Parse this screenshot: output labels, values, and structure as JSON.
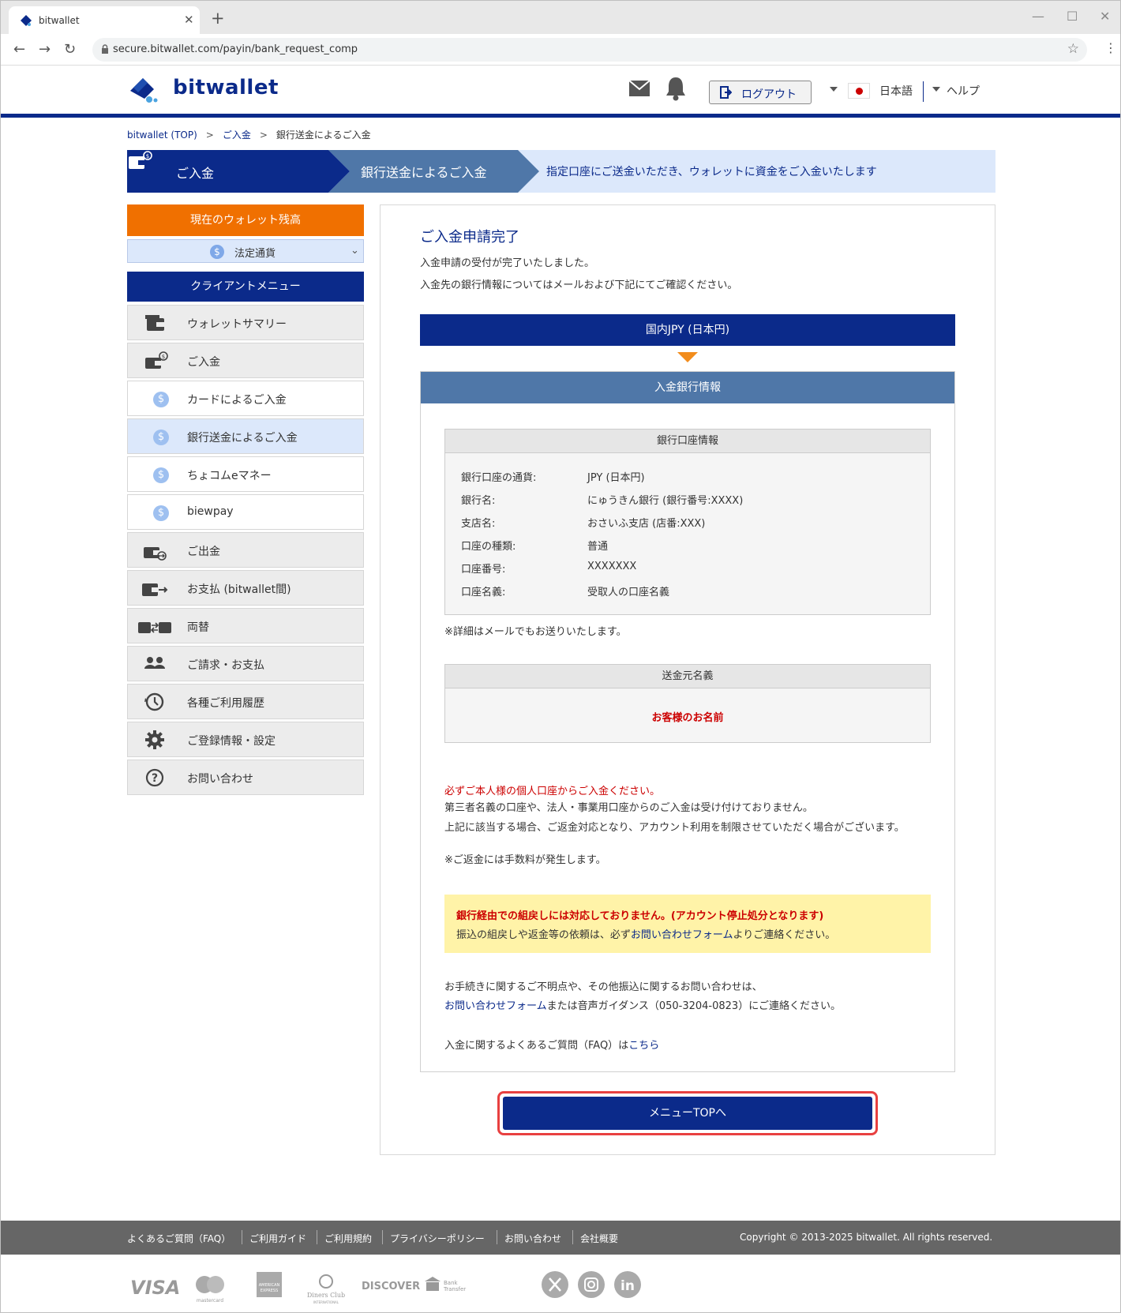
{
  "browser": {
    "tab_title": "bitwallet",
    "url": "secure.bitwallet.com/payin/bank_request_comp"
  },
  "header": {
    "logo_text": "bitwallet",
    "logout_label": "ログアウト",
    "language_label": "日本語",
    "help_label": "ヘルプ"
  },
  "breadcrumb": {
    "items": [
      "bitwallet (TOP)",
      "ご入金",
      "銀行送金によるご入金"
    ],
    "separator": ">"
  },
  "steps": {
    "step1": "ご入金",
    "step2": "銀行送金によるご入金",
    "step3": "指定口座にご送金いただき、ウォレットに資金をご入金いたします"
  },
  "sidebar": {
    "balance_header": "現在のウォレット残高",
    "balance_currency": "法定通貨",
    "menu_header": "クライアントメニュー",
    "items": [
      {
        "label": "ウォレットサマリー"
      },
      {
        "label": "ご入金"
      },
      {
        "label": "カードによるご入金"
      },
      {
        "label": "銀行送金によるご入金"
      },
      {
        "label": "ちょコムeマネー"
      },
      {
        "label": "biewpay"
      },
      {
        "label": "ご出金"
      },
      {
        "label": "お支払 (bitwallet間)"
      },
      {
        "label": "両替"
      },
      {
        "label": "ご請求・お支払"
      },
      {
        "label": "各種ご利用履歴"
      },
      {
        "label": "ご登録情報・設定"
      },
      {
        "label": "お問い合わせ"
      }
    ]
  },
  "main": {
    "title": "ご入金申請完了",
    "text1": "入金申請の受付が完了いたしました。",
    "text2": "入金先の銀行情報についてはメールおよび下記にてご確認ください。",
    "currency_bar": "国内JPY (日本円)",
    "info_header": "入金銀行情報",
    "account": {
      "header": "銀行口座情報",
      "rows": [
        {
          "k": "銀行口座の通貨:",
          "v": "JPY (日本円)"
        },
        {
          "k": "銀行名:",
          "v": "にゅうきん銀行 (銀行番号:XXXX)"
        },
        {
          "k": "支店名:",
          "v": "おさいふ支店 (店番:XXX)"
        },
        {
          "k": "口座の種類:",
          "v": "普通"
        },
        {
          "k": "口座番号:",
          "v": "XXXXXXX"
        },
        {
          "k": "口座名義:",
          "v": "受取人の口座名義"
        }
      ]
    },
    "note_mail": "※詳細はメールでもお送りいたします。",
    "sender": {
      "header": "送金元名義",
      "value": "お客様のお名前"
    },
    "warn_red": "必ずご本人様の個人口座からご入金ください。",
    "warn1": "第三者名義の口座や、法人・事業用口座からのご入金は受け付けておりません。",
    "warn2": "上記に該当する場合、ご返金対応となり、アカウント利用を制限させていただく場合がございます。",
    "warn3": "※ご返金には手数料が発生します。",
    "notice_red": "銀行経由での組戻しには対応しておりません。(アカウント停止処分となります)",
    "notice_pre": "振込の組戻しや返金等の依頼は、必ず",
    "notice_link": "お問い合わせフォーム",
    "notice_post": "よりご連絡ください。",
    "contact1": "お手続きに関するご不明点や、その他振込に関するお問い合わせは、",
    "contact_link": "お問い合わせフォーム",
    "contact2": "または音声ガイダンス（050-3204-0823）にご連絡ください。",
    "faq_pre": "入金に関するよくあるご質問（FAQ）は",
    "faq_link": "こちら",
    "button": "メニューTOPへ"
  },
  "footer": {
    "links": [
      "よくあるご質問（FAQ）",
      "ご利用ガイド",
      "ご利用規約",
      "プライバシーポリシー",
      "お問い合わせ",
      "会社概要"
    ],
    "copyright": "Copyright © 2013-2025 bitwallet. All rights reserved.",
    "payment_logos": [
      "VISA",
      "mastercard",
      "AMERICAN EXPRESS",
      "Diners Club INTERNATIONAL",
      "DISCOVER",
      "Bank Transfer"
    ],
    "social": [
      "x-icon",
      "instagram-icon",
      "linkedin-icon"
    ]
  },
  "colors": {
    "brand_navy": "#0b2a8a",
    "orange": "#f07000",
    "info_blue": "#4f77a8",
    "alert_red": "#cc0000",
    "notice_yellow": "#fff3a8",
    "button_outline": "#e84040"
  }
}
